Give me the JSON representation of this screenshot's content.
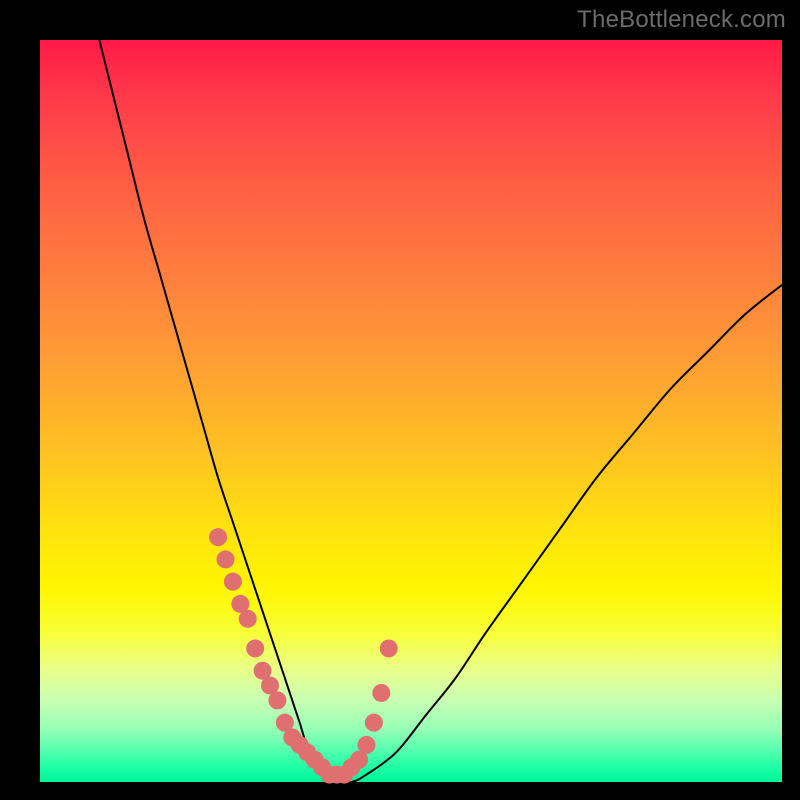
{
  "watermark": "TheBottleneck.com",
  "chart_data": {
    "type": "line",
    "title": "",
    "xlabel": "",
    "ylabel": "",
    "xlim": [
      0,
      100
    ],
    "ylim": [
      0,
      100
    ],
    "grid": false,
    "legend": false,
    "series": [
      {
        "name": "bottleneck-curve",
        "color": "#000000",
        "x": [
          8,
          10,
          12,
          14,
          16,
          18,
          20,
          22,
          24,
          26,
          28,
          30,
          32,
          33,
          34,
          35,
          36,
          38,
          40,
          42,
          44,
          48,
          52,
          56,
          60,
          65,
          70,
          75,
          80,
          85,
          90,
          95,
          100
        ],
        "y": [
          100,
          92,
          84,
          76,
          69,
          62,
          55,
          48,
          41,
          35,
          29,
          23,
          17,
          14,
          11,
          8,
          5,
          2,
          0,
          0,
          1,
          4,
          9,
          14,
          20,
          27,
          34,
          41,
          47,
          53,
          58,
          63,
          67
        ]
      },
      {
        "name": "highlight-dots",
        "color": "#e07070",
        "type": "scatter",
        "x": [
          24,
          25,
          26,
          27,
          28,
          29,
          30,
          31,
          32,
          33,
          34,
          35,
          36,
          37,
          38,
          39,
          40,
          41,
          42,
          43,
          44,
          45,
          46,
          47
        ],
        "y": [
          33,
          30,
          27,
          24,
          22,
          18,
          15,
          13,
          11,
          8,
          6,
          5,
          4,
          3,
          2,
          1,
          1,
          1,
          2,
          3,
          5,
          8,
          12,
          18
        ]
      }
    ]
  },
  "colors": {
    "gradient_top": "#ff1a47",
    "gradient_mid": "#ffe20f",
    "gradient_bottom": "#00f59b",
    "curve": "#000000",
    "dots": "#e07070",
    "frame": "#000000",
    "watermark": "#6b6b6b"
  }
}
